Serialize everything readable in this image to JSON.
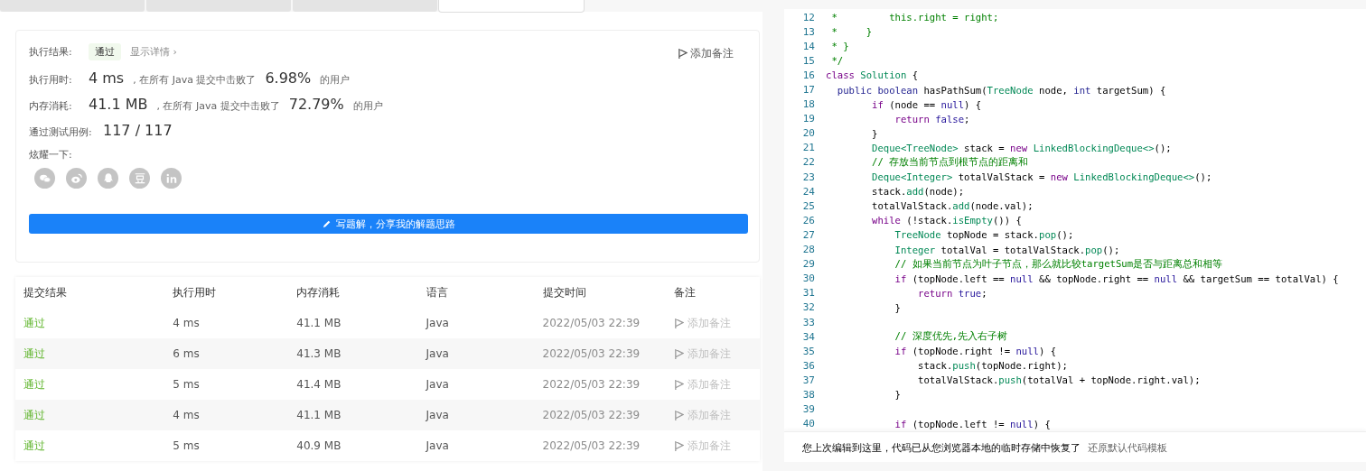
{
  "tabs": [
    {
      "selected": false
    },
    {
      "selected": false
    },
    {
      "selected": false
    },
    {
      "selected": true
    }
  ],
  "result": {
    "status_label": "执行结果:",
    "status": "通过",
    "details_link": "显示详情 ›",
    "add_note": "添加备注",
    "stats": [
      {
        "label": "执行用时:",
        "value": "4 ms",
        "text": ", 在所有 Java 提交中击败了",
        "percent": "6.98%",
        "suffix": "的用户"
      },
      {
        "label": "内存消耗:",
        "value": "41.1 MB",
        "text": ", 在所有 Java 提交中击败了",
        "percent": "72.79%",
        "suffix": "的用户"
      }
    ],
    "tests_label": "通过测试用例:",
    "tests": "117 / 117",
    "share_label": "炫耀一下:",
    "share": [
      {
        "kind": "chat"
      },
      {
        "kind": "weibo"
      },
      {
        "kind": "qq"
      },
      {
        "kind": "douban"
      },
      {
        "kind": "linkedin"
      }
    ],
    "write_button": "写题解，分享我的解题思路"
  },
  "table": {
    "columns": [
      "提交结果",
      "执行用时",
      "内存消耗",
      "语言",
      "提交时间",
      "备注"
    ],
    "rows": [
      {
        "result": "通过",
        "time": "4 ms",
        "memory": "41.1 MB",
        "language": "Java",
        "submitted": "2022/05/03 22:39",
        "note": "添加备注"
      },
      {
        "result": "通过",
        "time": "6 ms",
        "memory": "41.3 MB",
        "language": "Java",
        "submitted": "2022/05/03 22:39",
        "note": "添加备注"
      },
      {
        "result": "通过",
        "time": "5 ms",
        "memory": "41.4 MB",
        "language": "Java",
        "submitted": "2022/05/03 22:39",
        "note": "添加备注"
      },
      {
        "result": "通过",
        "time": "4 ms",
        "memory": "41.1 MB",
        "language": "Java",
        "submitted": "2022/05/03 22:39",
        "note": "添加备注"
      },
      {
        "result": "通过",
        "time": "5 ms",
        "memory": "40.9 MB",
        "language": "Java",
        "submitted": "2022/05/03 22:39",
        "note": "添加备注"
      }
    ]
  },
  "editor": {
    "lines": [
      {
        "number": "12",
        "tokens": [
          {
            "kind": "comment",
            "text": " *         this.right = right;"
          }
        ]
      },
      {
        "number": "13",
        "tokens": [
          {
            "kind": "comment",
            "text": " *     }"
          }
        ]
      },
      {
        "number": "14",
        "tokens": [
          {
            "kind": "comment",
            "text": " * }"
          }
        ]
      },
      {
        "number": "15",
        "tokens": [
          {
            "kind": "comment",
            "text": " */"
          }
        ]
      },
      {
        "number": "16",
        "tokens": [
          {
            "kind": "keyword",
            "text": "class"
          },
          {
            "kind": "type",
            "text": " Solution"
          },
          {
            "kind": "plain",
            "text": " {"
          }
        ]
      },
      {
        "number": "17",
        "tokens": [
          {
            "kind": "modifier",
            "text": "  public boolean"
          },
          {
            "kind": "plain",
            "text": " hasPathSum("
          },
          {
            "kind": "type",
            "text": "TreeNode"
          },
          {
            "kind": "plain",
            "text": " node, "
          },
          {
            "kind": "modifier",
            "text": "int"
          },
          {
            "kind": "plain",
            "text": " targetSum) {"
          }
        ]
      },
      {
        "number": "18",
        "tokens": [
          {
            "kind": "keyword",
            "text": "        if"
          },
          {
            "kind": "plain",
            "text": " (node == "
          },
          {
            "kind": "atom",
            "text": "null"
          },
          {
            "kind": "plain",
            "text": ") {"
          }
        ]
      },
      {
        "number": "19",
        "tokens": [
          {
            "kind": "keyword",
            "text": "            return"
          },
          {
            "kind": "atom",
            "text": " false"
          },
          {
            "kind": "plain",
            "text": ";"
          }
        ]
      },
      {
        "number": "20",
        "tokens": [
          {
            "kind": "plain",
            "text": "        }"
          }
        ]
      },
      {
        "number": "21",
        "tokens": [
          {
            "kind": "type",
            "text": "        Deque<TreeNode>"
          },
          {
            "kind": "plain",
            "text": " stack = "
          },
          {
            "kind": "keyword",
            "text": "new"
          },
          {
            "kind": "type",
            "text": " LinkedBlockingDeque<>"
          },
          {
            "kind": "plain",
            "text": "();"
          }
        ]
      },
      {
        "number": "22",
        "tokens": [
          {
            "kind": "comment",
            "text": "        // 存放当前节点到根节点的距离和"
          }
        ]
      },
      {
        "number": "23",
        "tokens": [
          {
            "kind": "type",
            "text": "        Deque<Integer>"
          },
          {
            "kind": "plain",
            "text": " totalValStack = "
          },
          {
            "kind": "keyword",
            "text": "new"
          },
          {
            "kind": "type",
            "text": " LinkedBlockingDeque<>"
          },
          {
            "kind": "plain",
            "text": "();"
          }
        ]
      },
      {
        "number": "24",
        "tokens": [
          {
            "kind": "plain",
            "text": "        stack."
          },
          {
            "kind": "type",
            "text": "add"
          },
          {
            "kind": "plain",
            "text": "(node);"
          }
        ]
      },
      {
        "number": "25",
        "tokens": [
          {
            "kind": "plain",
            "text": "        totalValStack."
          },
          {
            "kind": "type",
            "text": "add"
          },
          {
            "kind": "plain",
            "text": "(node.val);"
          }
        ]
      },
      {
        "number": "26",
        "tokens": [
          {
            "kind": "keyword",
            "text": "        while"
          },
          {
            "kind": "plain",
            "text": " (!stack."
          },
          {
            "kind": "type",
            "text": "isEmpty"
          },
          {
            "kind": "plain",
            "text": "()) {"
          }
        ]
      },
      {
        "number": "27",
        "tokens": [
          {
            "kind": "type",
            "text": "            TreeNode"
          },
          {
            "kind": "plain",
            "text": " topNode = stack."
          },
          {
            "kind": "type",
            "text": "pop"
          },
          {
            "kind": "plain",
            "text": "();"
          }
        ]
      },
      {
        "number": "28",
        "tokens": [
          {
            "kind": "type",
            "text": "            Integer"
          },
          {
            "kind": "plain",
            "text": " totalVal = totalValStack."
          },
          {
            "kind": "type",
            "text": "pop"
          },
          {
            "kind": "plain",
            "text": "();"
          }
        ]
      },
      {
        "number": "29",
        "tokens": [
          {
            "kind": "comment",
            "text": "            // 如果当前节点为叶子节点，那么就比较targetSum是否与距离总和相等"
          }
        ]
      },
      {
        "number": "30",
        "tokens": [
          {
            "kind": "keyword",
            "text": "            if"
          },
          {
            "kind": "plain",
            "text": " (topNode.left == "
          },
          {
            "kind": "atom",
            "text": "null"
          },
          {
            "kind": "plain",
            "text": " && topNode.right == "
          },
          {
            "kind": "atom",
            "text": "null"
          },
          {
            "kind": "plain",
            "text": " && targetSum == totalVal) {"
          }
        ]
      },
      {
        "number": "31",
        "tokens": [
          {
            "kind": "keyword",
            "text": "                return"
          },
          {
            "kind": "atom",
            "text": " true"
          },
          {
            "kind": "plain",
            "text": ";"
          }
        ]
      },
      {
        "number": "32",
        "tokens": [
          {
            "kind": "plain",
            "text": "            }"
          }
        ]
      },
      {
        "number": "33"
      },
      {
        "number": "34",
        "tokens": [
          {
            "kind": "comment",
            "text": "            // 深度优先,先入右子树"
          }
        ]
      },
      {
        "number": "35",
        "tokens": [
          {
            "kind": "keyword",
            "text": "            if"
          },
          {
            "kind": "plain",
            "text": " (topNode.right != "
          },
          {
            "kind": "atom",
            "text": "null"
          },
          {
            "kind": "plain",
            "text": ") {"
          }
        ]
      },
      {
        "number": "36",
        "tokens": [
          {
            "kind": "plain",
            "text": "                stack."
          },
          {
            "kind": "type",
            "text": "push"
          },
          {
            "kind": "plain",
            "text": "(topNode.right);"
          }
        ]
      },
      {
        "number": "37",
        "tokens": [
          {
            "kind": "plain",
            "text": "                totalValStack."
          },
          {
            "kind": "type",
            "text": "push"
          },
          {
            "kind": "plain",
            "text": "(totalVal + topNode.right.val);"
          }
        ]
      },
      {
        "number": "38",
        "tokens": [
          {
            "kind": "plain",
            "text": "            }"
          }
        ]
      },
      {
        "number": "39"
      },
      {
        "number": "40",
        "tokens": [
          {
            "kind": "keyword",
            "text": "            if"
          },
          {
            "kind": "plain",
            "text": " (topNode.left != "
          },
          {
            "kind": "atom",
            "text": "null"
          },
          {
            "kind": "plain",
            "text": ") {"
          }
        ]
      }
    ],
    "notice": {
      "text": "您上次编辑到这里，代码已从您浏览器本地的临时存储中恢复了",
      "action": "还原默认代码模板"
    }
  }
}
